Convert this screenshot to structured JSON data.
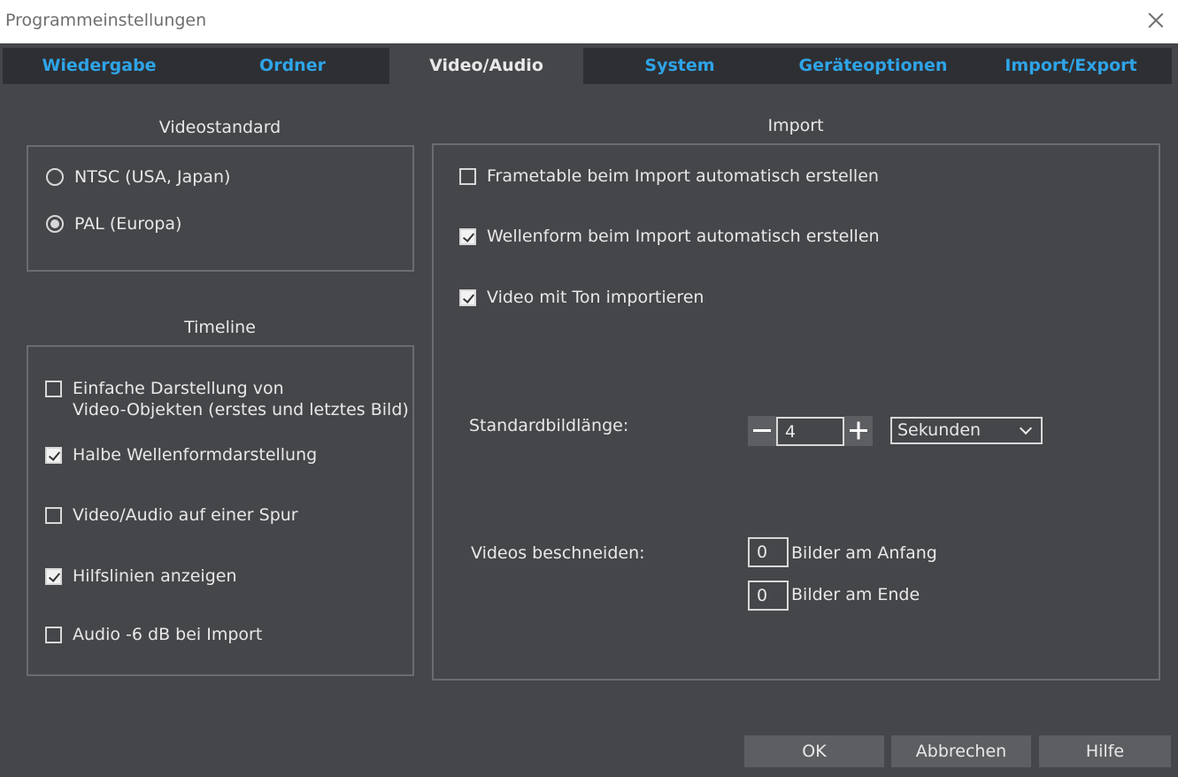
{
  "window": {
    "title": "Programmeinstellungen"
  },
  "tabs": [
    {
      "label": "Wiedergabe",
      "active": false
    },
    {
      "label": "Ordner",
      "active": false
    },
    {
      "label": "Video/Audio",
      "active": true
    },
    {
      "label": "System",
      "active": false
    },
    {
      "label": "Geräteoptionen",
      "active": false
    },
    {
      "label": "Import/Export",
      "active": false
    }
  ],
  "videostandard": {
    "label": "Videostandard",
    "options": [
      {
        "label": "NTSC (USA, Japan)",
        "selected": false
      },
      {
        "label": "PAL (Europa)",
        "selected": true
      }
    ]
  },
  "timeline": {
    "label": "Timeline",
    "options": [
      {
        "line1": "Einfache Darstellung von",
        "line2": "Video-Objekten (erstes und letztes Bild)",
        "checked": false
      },
      {
        "label": "Halbe Wellenformdarstellung",
        "checked": true
      },
      {
        "label": "Video/Audio auf einer Spur",
        "checked": false
      },
      {
        "label": "Hilfslinien anzeigen",
        "checked": true
      },
      {
        "label": "Audio -6 dB bei Import",
        "checked": false
      }
    ]
  },
  "import": {
    "label": "Import",
    "options": [
      {
        "label": "Frametable beim Import automatisch erstellen",
        "checked": false
      },
      {
        "label": "Wellenform beim Import automatisch erstellen",
        "checked": true
      },
      {
        "label": "Video mit Ton importieren",
        "checked": true
      }
    ],
    "standardbildlaenge": {
      "label": "Standardbildlänge:",
      "value": "4",
      "unit": "Sekunden"
    },
    "beschneiden": {
      "label": "Videos beschneiden:",
      "start_value": "0",
      "start_label": "Bilder am Anfang",
      "end_value": "0",
      "end_label": "Bilder am Ende"
    }
  },
  "buttons": {
    "ok": "OK",
    "cancel": "Abbrechen",
    "help": "Hilfe"
  },
  "colors": {
    "background": "#45464a",
    "tabbar": "#2e2f33",
    "tab_link": "#2ea4e8",
    "button": "#5d5e62"
  },
  "icons": {
    "close": "close-icon",
    "minus": "minus-icon",
    "plus": "plus-icon",
    "dropdown": "chevron-down-icon"
  }
}
